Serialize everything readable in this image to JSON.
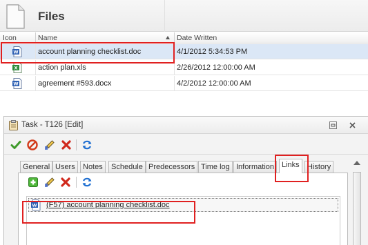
{
  "files_panel": {
    "title": "Files",
    "columns": {
      "icon": "Icon",
      "name": "Name",
      "date": "Date Written"
    },
    "sort": {
      "column": "name",
      "direction": "ascending"
    },
    "rows": [
      {
        "icon": "word-doc-icon",
        "name": "account planning checklist.doc",
        "date": "4/1/2012 5:34:53 PM",
        "selected": true
      },
      {
        "icon": "excel-icon",
        "name": "action plan.xls",
        "date": "2/26/2012 12:00:00 AM",
        "selected": false
      },
      {
        "icon": "word-doc-icon",
        "name": "agreement #593.docx",
        "date": "4/2/2012 12:00:00 AM",
        "selected": false
      }
    ]
  },
  "task_dialog": {
    "title": "Task - T126 [Edit]",
    "toolbar": [
      "save-check-icon",
      "cancel-icon",
      "edit-pencil-icon",
      "delete-x-icon",
      "refresh-icon"
    ],
    "tabs": [
      {
        "label": "General"
      },
      {
        "label": "Users"
      },
      {
        "label": "Notes"
      },
      {
        "label": "Schedule"
      },
      {
        "label": "Predecessors"
      },
      {
        "label": "Time log"
      },
      {
        "label": "Information"
      },
      {
        "label": "Links",
        "active": true
      },
      {
        "label": "History"
      }
    ],
    "links_toolbar": [
      "add-icon",
      "edit-pencil-icon",
      "delete-x-icon",
      "refresh-icon"
    ],
    "links": [
      {
        "icon": "word-doc-icon",
        "label": "(F57) account planning checklist.doc"
      }
    ]
  },
  "colors": {
    "highlight": "#e02020",
    "selected_row": "#dbe7f6"
  }
}
